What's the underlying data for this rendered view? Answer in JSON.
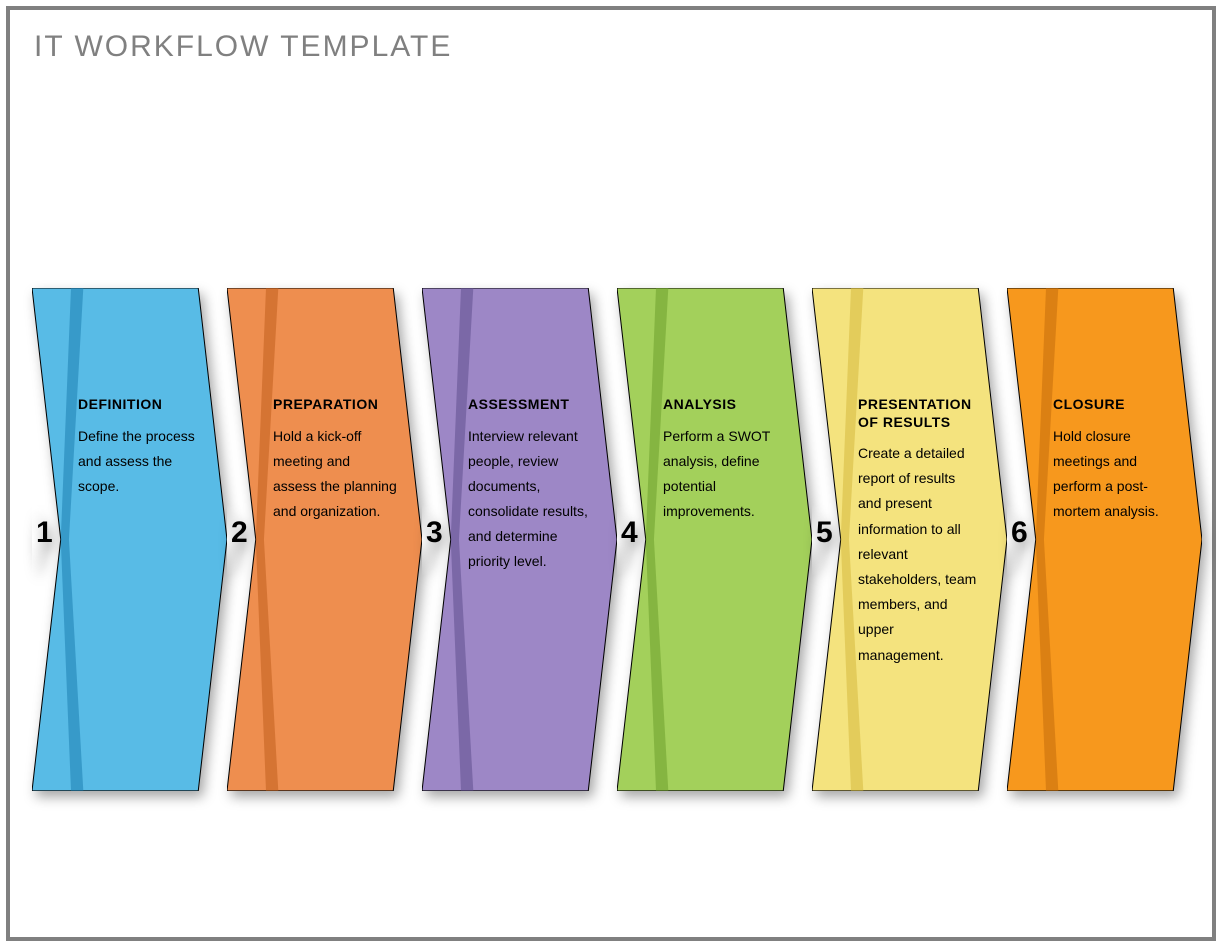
{
  "title": "IT WORKFLOW TEMPLATE",
  "steps": [
    {
      "num": "1",
      "title": "DEFINITION",
      "desc": "Define the process and assess the scope.",
      "fill": "#58BBE6",
      "shade": "#1E7FB0"
    },
    {
      "num": "2",
      "title": "PREPARATION",
      "desc": "Hold a kick-off meeting and assess the planning and organization.",
      "fill": "#EE8E4F",
      "shade": "#C15F1E"
    },
    {
      "num": "3",
      "title": "ASSESSMENT",
      "desc": "Interview relevant people, review documents, consolidate results, and determine priority level.",
      "fill": "#9D87C6",
      "shade": "#5E4E8E"
    },
    {
      "num": "4",
      "title": "ANALYSIS",
      "desc": "Perform a SWOT analysis, define potential improvements.",
      "fill": "#A3D05B",
      "shade": "#6E9E2B"
    },
    {
      "num": "5",
      "title": "PRESENTATION OF RESULTS",
      "desc": "Create a detailed report of results and present information to all relevant stakeholders, team members, and upper management.",
      "fill": "#F4E37E",
      "shade": "#D6B93E"
    },
    {
      "num": "6",
      "title": "CLOSURE",
      "desc": "Hold closure meetings and perform a post-mortem analysis.",
      "fill": "#F7981D",
      "shade": "#C46E0B"
    }
  ]
}
